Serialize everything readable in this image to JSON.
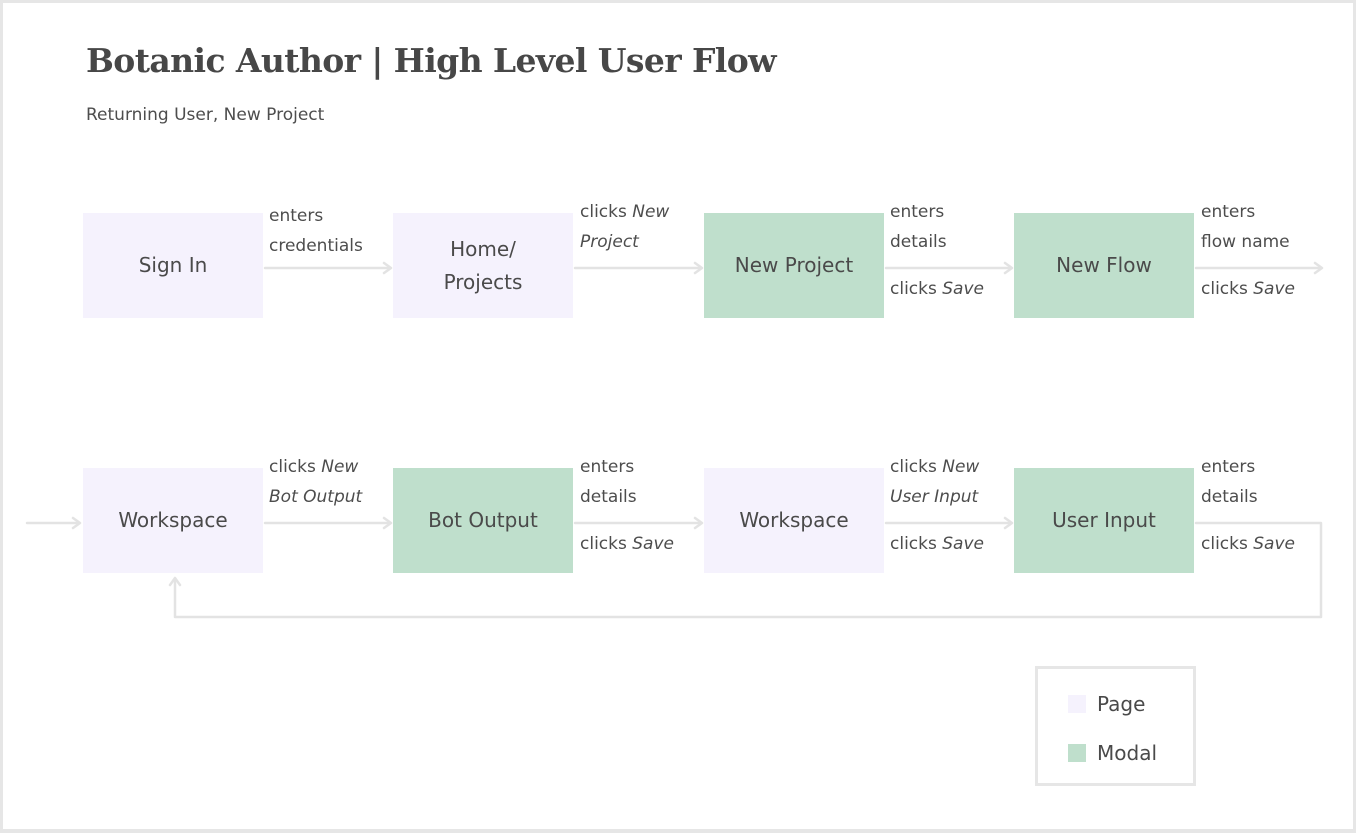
{
  "header": {
    "title": "Botanic Author | High Level User Flow",
    "subtitle": "Returning User, New Project"
  },
  "colors": {
    "page": "#f5f2fd",
    "modal": "#bfdfcc",
    "connector": "#e3e3e3"
  },
  "nodes": {
    "sign_in": "Sign In",
    "home_projects": "Home/\nProjects",
    "new_project": "New Project",
    "new_flow": "New Flow",
    "workspace_1": "Workspace",
    "bot_output": "Bot Output",
    "workspace_2": "Workspace",
    "user_input": "User Input"
  },
  "edges": {
    "e1": {
      "l1": "enters",
      "l2": "credentials"
    },
    "e2": {
      "l1a": "clicks ",
      "l1b": "New",
      "l2": "Project"
    },
    "e3": {
      "l1": "enters",
      "l2": "details",
      "l3a": "clicks ",
      "l3b": "Save"
    },
    "e4": {
      "l1": "enters",
      "l2": "flow name",
      "l3a": "clicks ",
      "l3b": "Save"
    },
    "e5": {
      "l1a": "clicks ",
      "l1b": "New",
      "l2": "Bot Output"
    },
    "e6": {
      "l1": "enters",
      "l2": "details",
      "l3a": "clicks ",
      "l3b": "Save"
    },
    "e7": {
      "l1a": "clicks ",
      "l1b": "New",
      "l2": "User Input"
    },
    "e8": {
      "l1": "enters",
      "l2": "details",
      "l3a": "clicks ",
      "l3b": "Save"
    }
  },
  "legend": {
    "page": "Page",
    "modal": "Modal"
  }
}
